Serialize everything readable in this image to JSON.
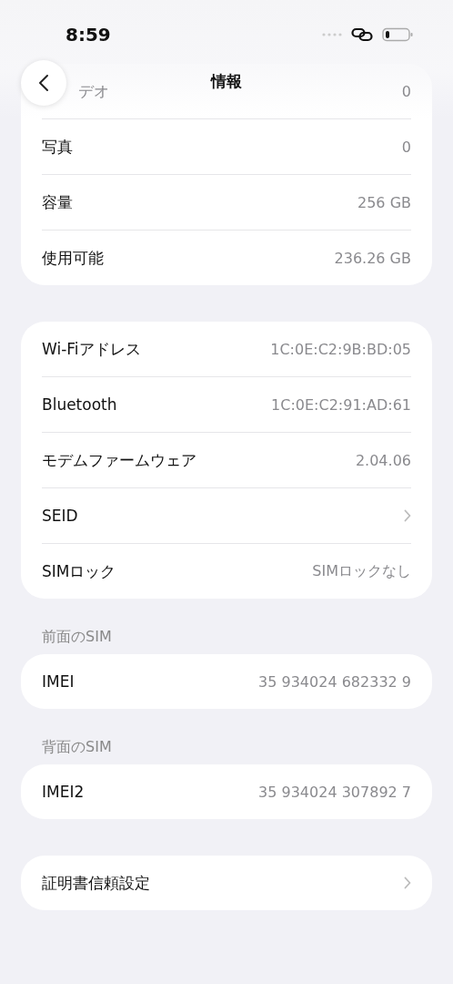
{
  "status_bar": {
    "time": "8:59"
  },
  "nav": {
    "title": "情報"
  },
  "faded_row": {
    "label": "デオ",
    "value": "0"
  },
  "groups": [
    {
      "rows": [
        {
          "label": "写真",
          "value": "0",
          "kind": "value"
        },
        {
          "label": "容量",
          "value": "256 GB",
          "kind": "value"
        },
        {
          "label": "使用可能",
          "value": "236.26 GB",
          "kind": "value"
        }
      ]
    },
    {
      "rows": [
        {
          "label": "Wi-Fiアドレス",
          "value": "1C:0E:C2:9B:BD:05",
          "kind": "value"
        },
        {
          "label": "Bluetooth",
          "value": "1C:0E:C2:91:AD:61",
          "kind": "value"
        },
        {
          "label": "モデムファームウェア",
          "value": "2.04.06",
          "kind": "value"
        },
        {
          "label": "SEID",
          "kind": "link"
        },
        {
          "label": "SIMロック",
          "value": "SIMロックなし",
          "kind": "value"
        }
      ]
    },
    {
      "header": "前面のSIM",
      "rows": [
        {
          "label": "IMEI",
          "value": "35 934024 682332 9",
          "kind": "value"
        }
      ]
    },
    {
      "header": "背面のSIM",
      "rows": [
        {
          "label": "IMEI2",
          "value": "35 934024 307892 7",
          "kind": "value"
        }
      ]
    },
    {
      "rows": [
        {
          "label": "証明書信頼設定",
          "kind": "link"
        }
      ]
    }
  ]
}
